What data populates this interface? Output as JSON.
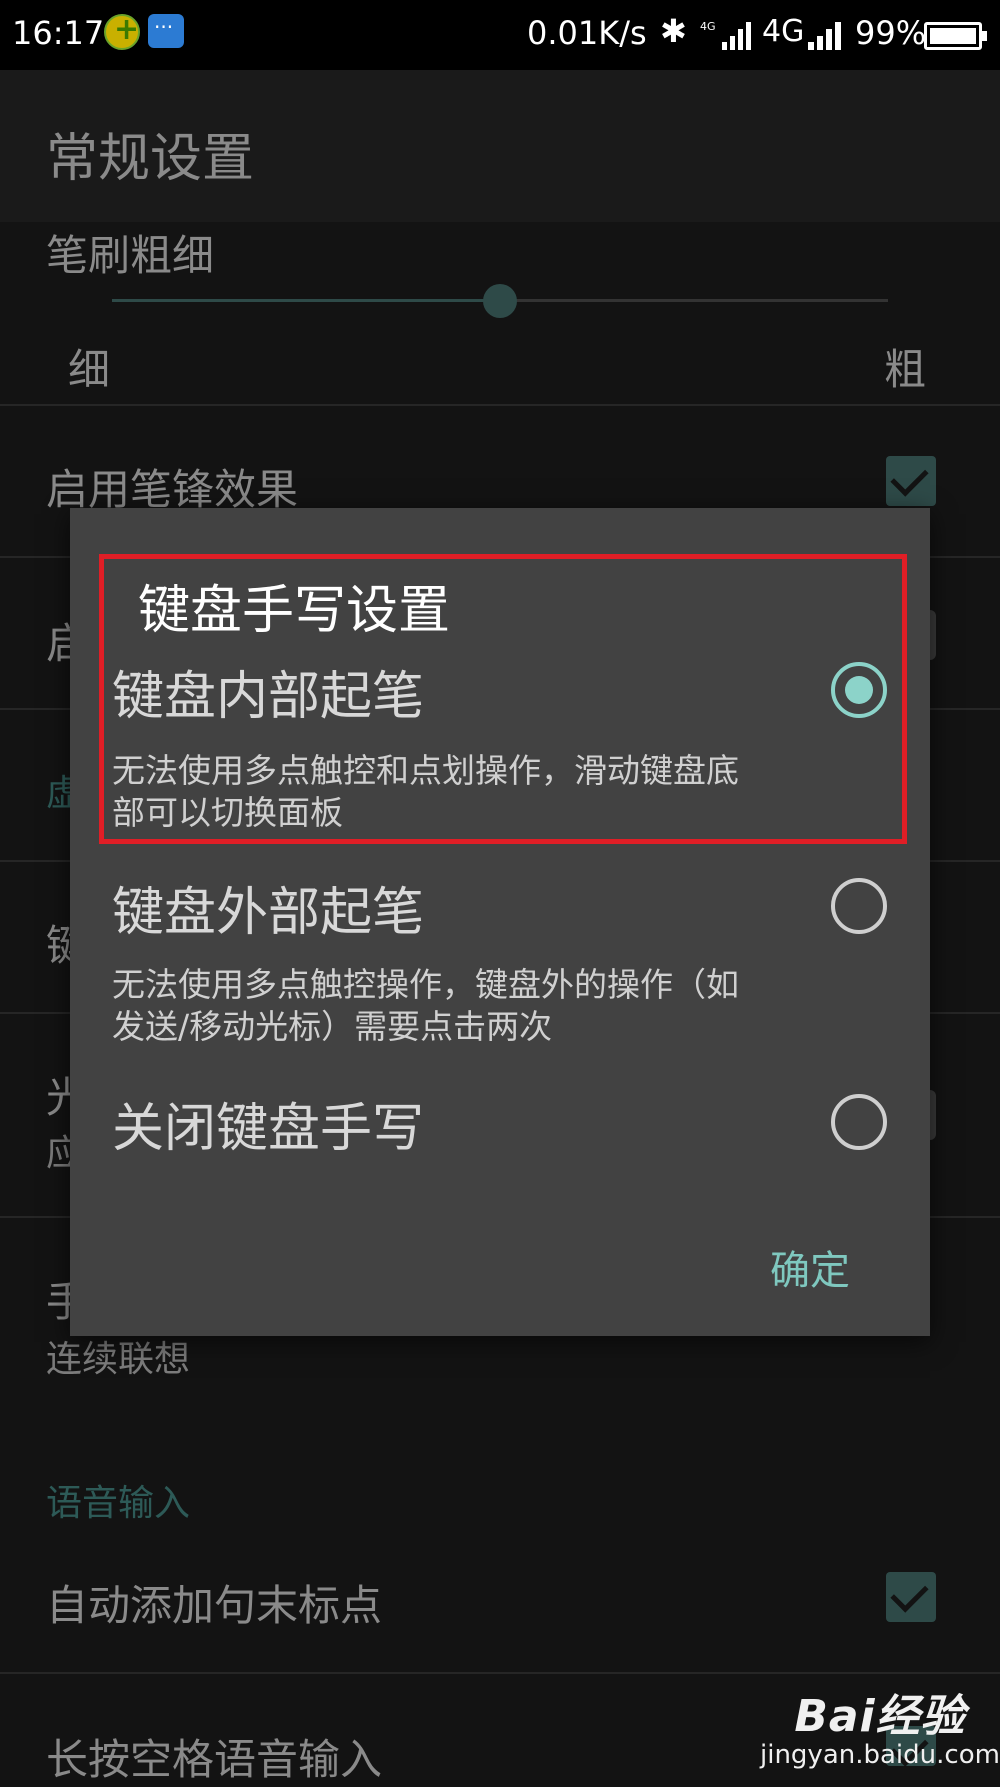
{
  "status_bar": {
    "time": "16:17",
    "net_speed": "0.01K/s",
    "network": "4G",
    "battery": "99%",
    "icons": [
      "app-notification-icon",
      "message-icon",
      "bluetooth-icon",
      "signal-icon",
      "battery-icon"
    ]
  },
  "app_bar": {
    "title": "常规设置"
  },
  "settings": {
    "brush_width": {
      "label": "笔刷粗细",
      "min_label": "细",
      "max_label": "粗",
      "level": 0.5
    },
    "pen_tip": {
      "label": "启用笔锋效果",
      "checked": true
    },
    "row_2_partial": "启",
    "row_3_partial": "虚",
    "row_4_partial": "键",
    "row_5_partial_a": "光",
    "row_5_partial_b": "应",
    "row_6_partial": "手",
    "row_6_sub": "连续联想",
    "voice_section": "语音输入",
    "auto_punct": {
      "label": "自动添加句末标点",
      "checked": true
    },
    "long_press_space": {
      "label": "长按空格语音输入",
      "checked": true
    }
  },
  "dialog": {
    "title": "键盘手写设置",
    "options": [
      {
        "title": "键盘内部起笔",
        "desc": "无法使用多点触控和点划操作，滑动键盘底部可以切换面板",
        "selected": true
      },
      {
        "title": "键盘外部起笔",
        "desc": "无法使用多点触控操作，键盘外的操作（如发送/移动光标）需要点击两次",
        "selected": false
      },
      {
        "title": "关闭键盘手写",
        "desc": "",
        "selected": false
      }
    ],
    "ok_label": "确定"
  },
  "watermark": {
    "logo": "Bai经验",
    "url": "jingyan.baidu.com"
  },
  "colors": {
    "accent": "#8cd3c9",
    "accent_dim": "#2e4a48",
    "dialog_bg": "#424242",
    "highlight": "#e01e26"
  }
}
